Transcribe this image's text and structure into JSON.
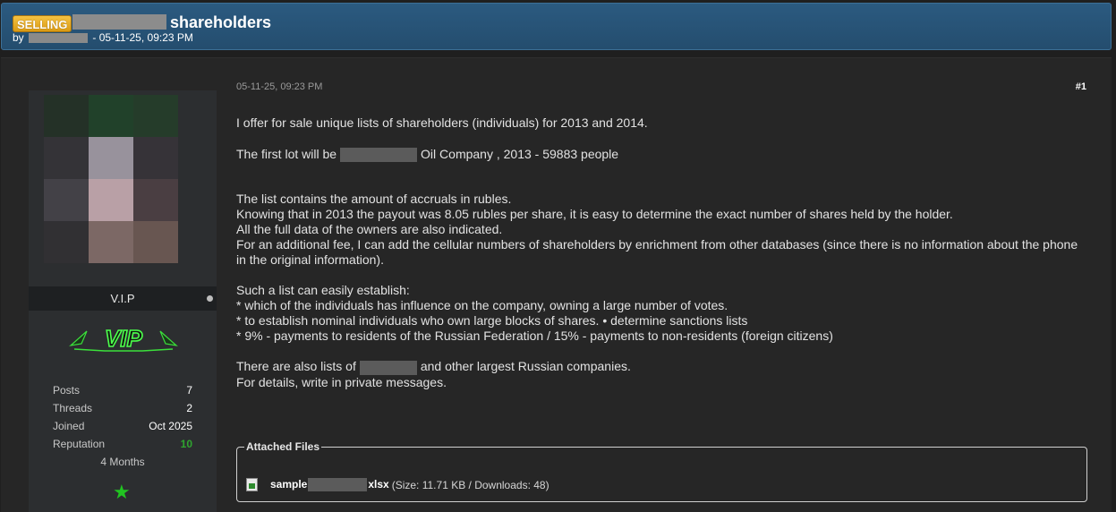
{
  "thread": {
    "prefix": "SELLING",
    "title": "shareholders",
    "by_label": "by",
    "date_separator": "- 05-11-25, 09:23 PM"
  },
  "user": {
    "rank": "V.I.P",
    "badge_text": "VIP",
    "stats": [
      {
        "label": "Posts",
        "value": "7"
      },
      {
        "label": "Threads",
        "value": "2"
      },
      {
        "label": "Joined",
        "value": "Oct 2025"
      },
      {
        "label": "Reputation",
        "value": "10"
      }
    ],
    "member_for": "4 Months",
    "colors": {
      "reputation": "#2fa52f",
      "star": "#21c421"
    },
    "award_icon": "star-icon"
  },
  "post": {
    "date": "05-11-25, 09:23 PM",
    "number": "#1",
    "para1": "I offer for sale unique lists of shareholders (individuals) for 2013 and 2014.",
    "para2_prefix": "The first lot will be",
    "para2_suffix": "Oil Company , 2013 - 59883 people",
    "lines_block1": [
      "The list contains the amount of accruals in rubles.",
      "Knowing that in 2013 the payout was 8.05 rubles per share, it is easy to determine the exact number of shares held by the holder.",
      "All the full data of the owners are also indicated.",
      "For an additional fee, I can add the cellular numbers of shareholders by enrichment from other databases (since there is no information about the phone in the original information)."
    ],
    "lines_block2": [
      "Such a list can easily establish:",
      "* which of the individuals has influence on the company, owning a large number of votes.",
      "* to establish nominal individuals who own large blocks of shares. • determine sanctions lists",
      "* 9% - payments to residents of the Russian Federation / 15% - payments to non-residents (foreign citizens)"
    ],
    "para_last_prefix": "There are also lists of",
    "para_last_suffix": "and other largest Russian companies.",
    "para_last_line2": "For details, write in private messages."
  },
  "attachments": {
    "legend": "Attached Files",
    "file_name_prefix": "sample",
    "file_name_suffix": "xlsx",
    "file_meta": "(Size: 11.71 KB / Downloads: 48)",
    "file_icon": "spreadsheet-file-icon"
  }
}
